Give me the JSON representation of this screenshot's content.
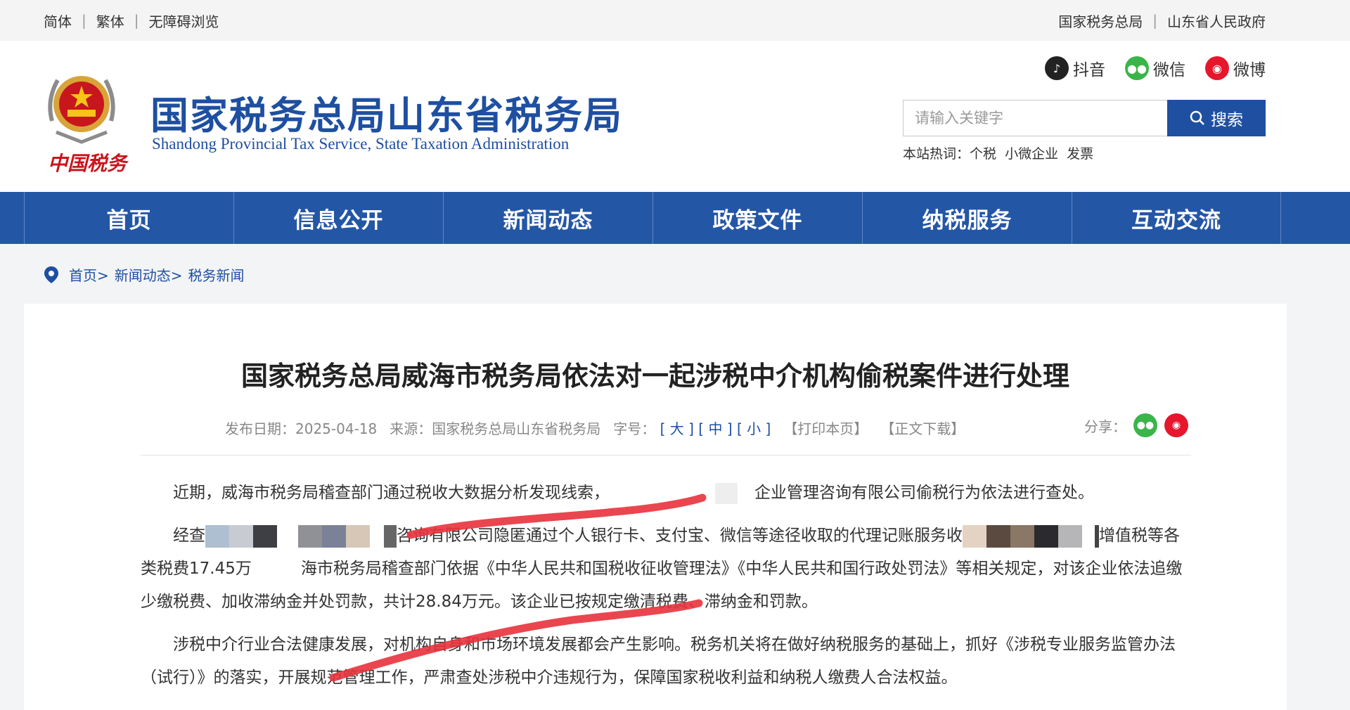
{
  "topbar": {
    "left_links": [
      "简体",
      "繁体",
      "无障碍浏览"
    ],
    "right_links": [
      "国家税务总局",
      "山东省人民政府"
    ]
  },
  "header": {
    "emblem_text": "中国税务",
    "title": "国家税务总局山东省税务局",
    "subtitle": "Shandong Provincial Tax Service, State Taxation Administration",
    "social": [
      {
        "label": "抖音",
        "icon": "douyin-icon"
      },
      {
        "label": "微信",
        "icon": "wechat-icon"
      },
      {
        "label": "微博",
        "icon": "weibo-icon"
      }
    ],
    "search": {
      "placeholder": "请输入关键字",
      "button_label": "搜索"
    },
    "hotwords": {
      "label": "本站热词：",
      "words": [
        "个税",
        "小微企业",
        "发票"
      ]
    }
  },
  "nav": {
    "items": [
      "首页",
      "信息公开",
      "新闻动态",
      "政策文件",
      "纳税服务",
      "互动交流"
    ]
  },
  "breadcrumb": {
    "items": [
      "首页>",
      "新闻动态>",
      "税务新闻"
    ]
  },
  "article": {
    "title": "国家税务总局威海市税务局依法对一起涉税中介机构偷税案件进行处理",
    "meta": {
      "date_label": "发布日期：2025-04-18",
      "source_label": "来源：国家税务总局山东省税务局",
      "font_label": "字号：",
      "font_sizes": [
        "大",
        "中",
        "小"
      ],
      "print_label": "【打印本页】",
      "download_label": "【正文下载】",
      "share_label": "分享："
    },
    "paragraphs": {
      "p1a": "近期，威海市税务局稽查部门通过税收大数据分析发现线索，",
      "p1b": "企业管理咨询有限公司偷税行为依法进行查处。",
      "p2a": "经查",
      "p2b": "咨询有限公司隐匿通过个人银行卡、支付宝、微信等途径收取的代理记账服务收",
      "p2c": "增值税等各类税费17.45万",
      "p2d": "海市税务局稽查部门依据《中华人民共和国税收征收管理法》《中华人民共和国行政处罚法》等相关规定，对该企业依法追缴少缴税费、加收滞纳金并处罚款，共计28.84万元。该企业已按规定缴清税费、滞纳金和罚款。",
      "p3": "涉税中介行业合法健康发展，对机构自身和市场环境发展都会产生影响。税务机关将在做好纳税服务的基础上，抓好《涉税专业服务监管办法（试行）》的落实，开展规范管理工作，严肃查处涉税中介违规行为，保障国家税收利益和纳税人缴费人合法权益。"
    }
  },
  "colors": {
    "brand_blue": "#1e4fa1",
    "nav_blue": "#2456a6",
    "marker_red": "#e8323c"
  }
}
